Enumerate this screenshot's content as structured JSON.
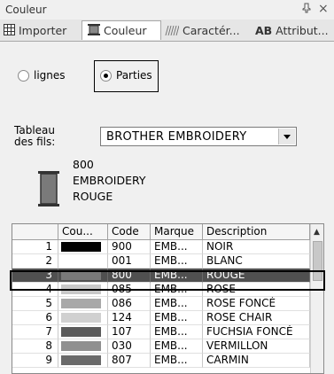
{
  "window": {
    "title": "Couleur",
    "pin_glyph": "ⴰ",
    "close_glyph": "×"
  },
  "tabs": [
    {
      "label": "Importer",
      "icon": "import-table-icon"
    },
    {
      "label": "Couleur",
      "icon": "thread-spool-icon"
    },
    {
      "label": "Caractér...",
      "icon": "pattern-icon"
    },
    {
      "label_bold": "AB",
      "label": " Attribut...",
      "icon": "text-ab-icon"
    }
  ],
  "radios": {
    "lignes": "lignes",
    "parties": "Parties",
    "selected": "parties"
  },
  "thread_table": {
    "label": "Tableau des fils:",
    "value": "BROTHER EMBROIDERY"
  },
  "current_thread": {
    "number": "800",
    "brand": "EMBROIDERY",
    "name": "ROUGE",
    "color": "#7a7a7a"
  },
  "grid": {
    "headers": [
      "",
      "Cou...",
      "Code",
      "Marque",
      "Description"
    ],
    "rows": [
      {
        "n": "1",
        "color": "#000000",
        "code": "900",
        "brand": "EMB...",
        "desc": "NOIR"
      },
      {
        "n": "2",
        "color": "#ffffff",
        "code": "001",
        "brand": "EMB...",
        "desc": "BLANC"
      },
      {
        "n": "3",
        "color": "#7a7a7a",
        "code": "800",
        "brand": "EMB...",
        "desc": "ROUGE",
        "selected": true
      },
      {
        "n": "4",
        "color": "#c8c8c8",
        "code": "085",
        "brand": "EMB...",
        "desc": "ROSE"
      },
      {
        "n": "5",
        "color": "#a8a8a8",
        "code": "086",
        "brand": "EMB...",
        "desc": "ROSE FONCÉ"
      },
      {
        "n": "6",
        "color": "#d0d0d0",
        "code": "124",
        "brand": "EMB...",
        "desc": "ROSE CHAIR"
      },
      {
        "n": "7",
        "color": "#5a5a5a",
        "code": "107",
        "brand": "EMB...",
        "desc": "FUCHSIA FONCÉ"
      },
      {
        "n": "8",
        "color": "#909090",
        "code": "030",
        "brand": "EMB...",
        "desc": "VERMILLON"
      },
      {
        "n": "9",
        "color": "#6a6a6a",
        "code": "807",
        "brand": "EMB...",
        "desc": "CARMIN"
      }
    ]
  }
}
